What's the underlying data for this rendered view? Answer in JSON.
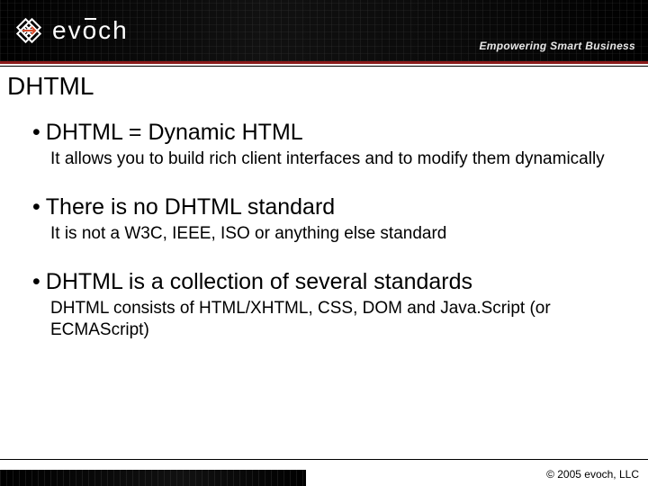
{
  "brand": {
    "logo_text": "evōch",
    "tagline": "Empowering Smart Business"
  },
  "slide": {
    "title": "DHTML",
    "bullets": [
      {
        "head": "DHTML = Dynamic HTML",
        "desc": "It allows you to build rich client interfaces and to modify them dynamically"
      },
      {
        "head": "There is no DHTML standard",
        "desc": "It is not a W3C, IEEE, ISO or anything else standard"
      },
      {
        "head": "DHTML is a collection of several standards",
        "desc": "DHTML consists of HTML/XHTML, CSS, DOM and Java.Script (or ECMAScript)"
      }
    ]
  },
  "footer": {
    "copyright": "© 2005 evoch, LLC"
  }
}
